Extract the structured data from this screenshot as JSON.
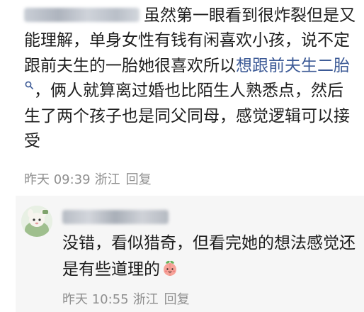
{
  "comment": {
    "text_before_link": "虽然第一眼看到很炸裂但是又能理解，单身女性有钱有闲喜欢小孩，说不定跟前夫生的一胎她很喜欢所以",
    "link_text": "想跟前夫生二胎",
    "text_after_link": "，俩人就算离过婚也比陌生人熟悉点，然后生了两个孩子也是同父同母，感觉逻辑可以接受",
    "time": "昨天 09:39",
    "location": "浙江",
    "reply_label": "回复"
  },
  "reply_comment": {
    "text": "没错，看似猎奇，但看完她的想法感觉还是有些道理的",
    "emoji": "peach-face-emoji",
    "time": "昨天 10:55",
    "location": "浙江",
    "reply_label": "回复"
  },
  "colors": {
    "link": "#3c5a96",
    "meta": "#8f8f8f",
    "text": "#1e1e1e",
    "reply_background": "#f6f6f6"
  }
}
